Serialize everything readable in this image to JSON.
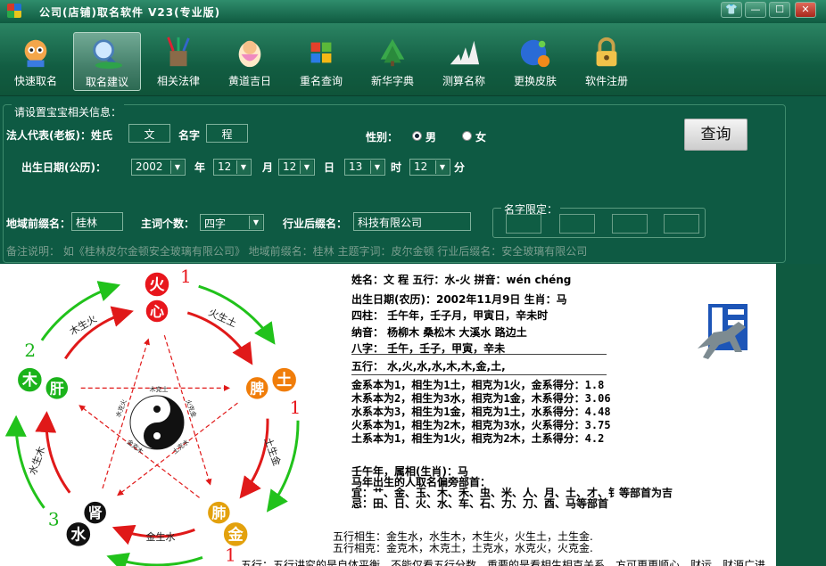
{
  "window": {
    "title": "公司(店铺)取名软件 V23(专业版)",
    "controls": [
      "👕",
      "—",
      "☐",
      "✕"
    ]
  },
  "toolbar": [
    {
      "label": "快速取名",
      "icon": "mascot-icon"
    },
    {
      "label": "取名建议",
      "icon": "magnifier-icon",
      "active": true
    },
    {
      "label": "相关法律",
      "icon": "pen-holder-icon"
    },
    {
      "label": "黄道吉日",
      "icon": "baby-icon"
    },
    {
      "label": "重名查询",
      "icon": "windows-logo-icon"
    },
    {
      "label": "新华字典",
      "icon": "tree-icon"
    },
    {
      "label": "测算名称",
      "icon": "adidas-logo-icon"
    },
    {
      "label": "更换皮肤",
      "icon": "globe-icon"
    },
    {
      "label": "软件注册",
      "icon": "lock-icon"
    }
  ],
  "settings": {
    "group_title": "请设置宝宝相关信息：",
    "owner_label": "法人代表(老板)：姓氏",
    "surname": "文",
    "name_label": "名字",
    "given_name": "程",
    "gender_label": "性别：",
    "gender_options": [
      "男",
      "女"
    ],
    "gender_selected": "男",
    "query_button": "查询",
    "birth_label": "出生日期(公历)：",
    "year": "2002",
    "year_unit": "年",
    "month": "12",
    "month_unit": "月",
    "day": "12",
    "day_unit": "日",
    "hour": "13",
    "hour_unit": "时",
    "minute": "12",
    "minute_unit": "分",
    "region_label": "地域前缀名：",
    "region": "桂林",
    "wordcount_label": "主词个数：",
    "wordcount": "四字",
    "industry_label": "行业后缀名：",
    "industry": "科技有限公司",
    "limit_label": "名字限定：",
    "note": "备注说明：  如《桂林皮尔金顿安全玻璃有限公司》   地域前缀名：桂林          主题字词：皮尔金顿          行业后缀名：安全玻璃有限公司"
  },
  "info": {
    "line1": "姓名：文  程      五行：水-火     拼音：wén chéng",
    "lunar": "出生日期(农历)：2002年11月9日       生肖：马",
    "sizhu": "四柱： 壬午年，壬子月，甲寅日，辛未时",
    "nayin": "纳音： 杨柳木   桑松木   大溪水   路边土",
    "bazi": "八字： 壬午，壬子，甲寅，辛未",
    "wuxing": "五行： 水,火,水,水,木,木,金,土,",
    "scores": [
      "金系本为1，相生为1土，相克为1火，金系得分：1.8",
      "木系本为2，相生为3水，相克为1金，木系得分：3.06",
      "水系本为3，相生为1金，相克为1土，水系得分：4.48",
      "火系本为1，相生为2木，相克为3水，火系得分：3.75",
      "土系本为1，相生为1火，相克为2木，土系得分：4.2"
    ],
    "zodiac1": "壬午年，属相(生肖)：马",
    "zodiac2": "马年出生的人取名偏旁部首：",
    "zodiac3": "宜：艹、金、玉、木、禾、虫、米、人、月、土、才、钅等部首为吉",
    "zodiac4": "忌：田、日、火、水、车、石、力、刀、酉、马等部首",
    "rel1": "五行相生：金生水，水生木，木生火，火生土，土生金.",
    "rel2": "五行相克：金克木，木克土，土克水，水克火，火克金.",
    "bottom": "五行：五行讲究的是自体平衡，不能仅看五行分数，重要的是看相生相克关系，方可更更顺心，财运，财源广进"
  },
  "diagram": {
    "elements": [
      {
        "el": "火",
        "organ": "心",
        "num": "1"
      },
      {
        "el": "土",
        "organ": "脾",
        "num": "1"
      },
      {
        "el": "金",
        "organ": "肺",
        "num": "1"
      },
      {
        "el": "水",
        "organ": "肾",
        "num": "3"
      },
      {
        "el": "木",
        "organ": "肝",
        "num": "2"
      }
    ],
    "generate_labels": [
      "火生土",
      "土生金",
      "金生水",
      "水生木",
      "木生火"
    ],
    "restrain_labels": [
      "木克土",
      "火克金",
      "土克水",
      "金克木",
      "水克火"
    ],
    "colors": {
      "fire": "#e8161c",
      "earth": "#f07d0a",
      "metal": "#e3a10d",
      "water": "#111111",
      "wood": "#1bb31b",
      "arrow_green": "#21c21b",
      "arrow_red": "#e01919"
    }
  }
}
